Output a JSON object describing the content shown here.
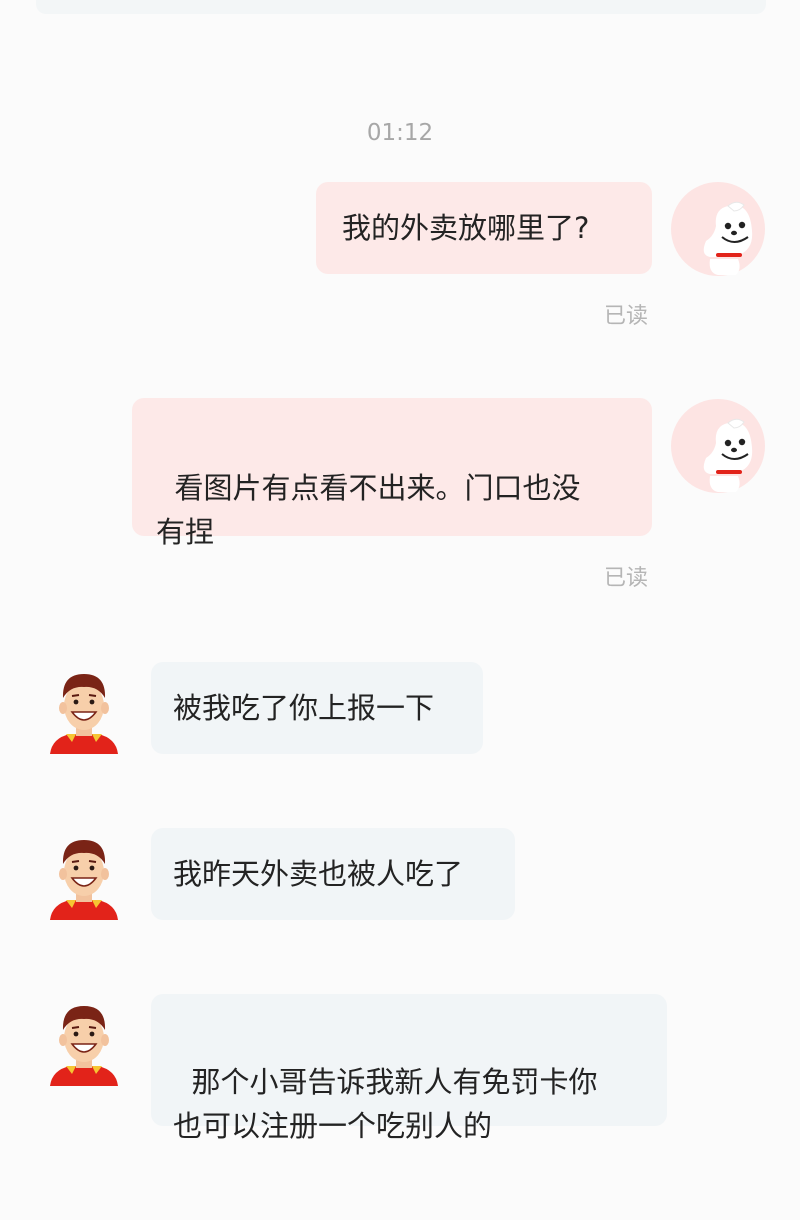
{
  "conversation": {
    "timestamp": "01:12",
    "messages": [
      {
        "from": "me",
        "text": "我的外卖放哪里了?",
        "status": "已读",
        "avatar": "joy-dog-avatar"
      },
      {
        "from": "me",
        "text": "看图片有点看不出来。门口也没\n有捏",
        "status": "已读",
        "avatar": "joy-dog-avatar"
      },
      {
        "from": "courier",
        "text": "被我吃了你上报一下",
        "avatar": "courier-avatar"
      },
      {
        "from": "courier",
        "text": "我昨天外卖也被人吃了",
        "avatar": "courier-avatar"
      },
      {
        "from": "courier",
        "text": "那个小哥告诉我新人有免罚卡你\n也可以注册一个吃别人的",
        "avatar": "courier-avatar"
      }
    ]
  },
  "colors": {
    "page_background": "#fbfbfb",
    "my_bubble": "#fde9e8",
    "their_bubble": "#f1f5f7",
    "text": "#232323",
    "meta_text": "#a7a7a7",
    "brand_red": "#e2231a"
  }
}
